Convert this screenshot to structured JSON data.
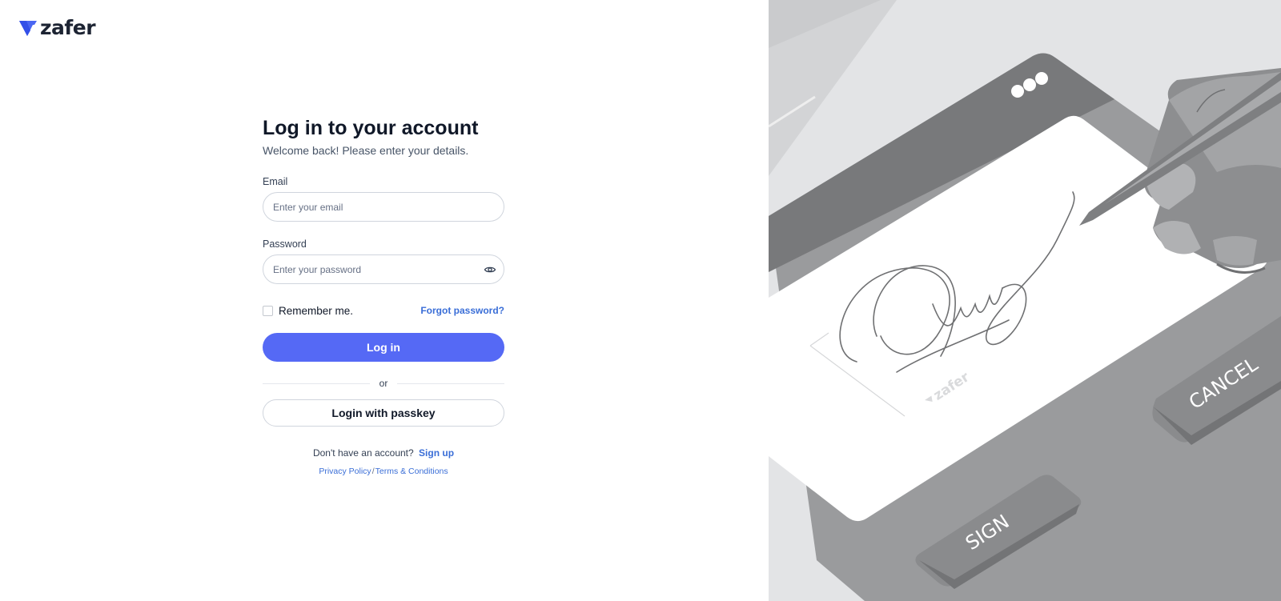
{
  "brand": {
    "name": "zafer",
    "color": "#4a66f2"
  },
  "login": {
    "title": "Log in to your account",
    "subtitle": "Welcome back! Please enter your details.",
    "email_label": "Email",
    "email_placeholder": "Enter your email",
    "email_value": "",
    "password_label": "Password",
    "password_placeholder": "Enter your password",
    "password_value": "",
    "password_toggle_icon": "eye-icon",
    "remember_label": "Remember me.",
    "remember_checked": false,
    "forgot_label": "Forgot password?",
    "submit_label": "Log in",
    "divider_label": "or",
    "passkey_label": "Login with passkey",
    "no_account_text": "Don't have an account?",
    "signup_label": "Sign up",
    "privacy_label": "Privacy Policy",
    "legal_separator": "/",
    "terms_label": "Terms & Conditions"
  },
  "illustration": {
    "cancel_label": "CANCEL",
    "sign_label": "SIGN",
    "watermark_label": "zafer"
  },
  "colors": {
    "primary_button": "#5569f5",
    "link": "#3a6ed7",
    "illustration_bg": "#e3e4e6"
  }
}
